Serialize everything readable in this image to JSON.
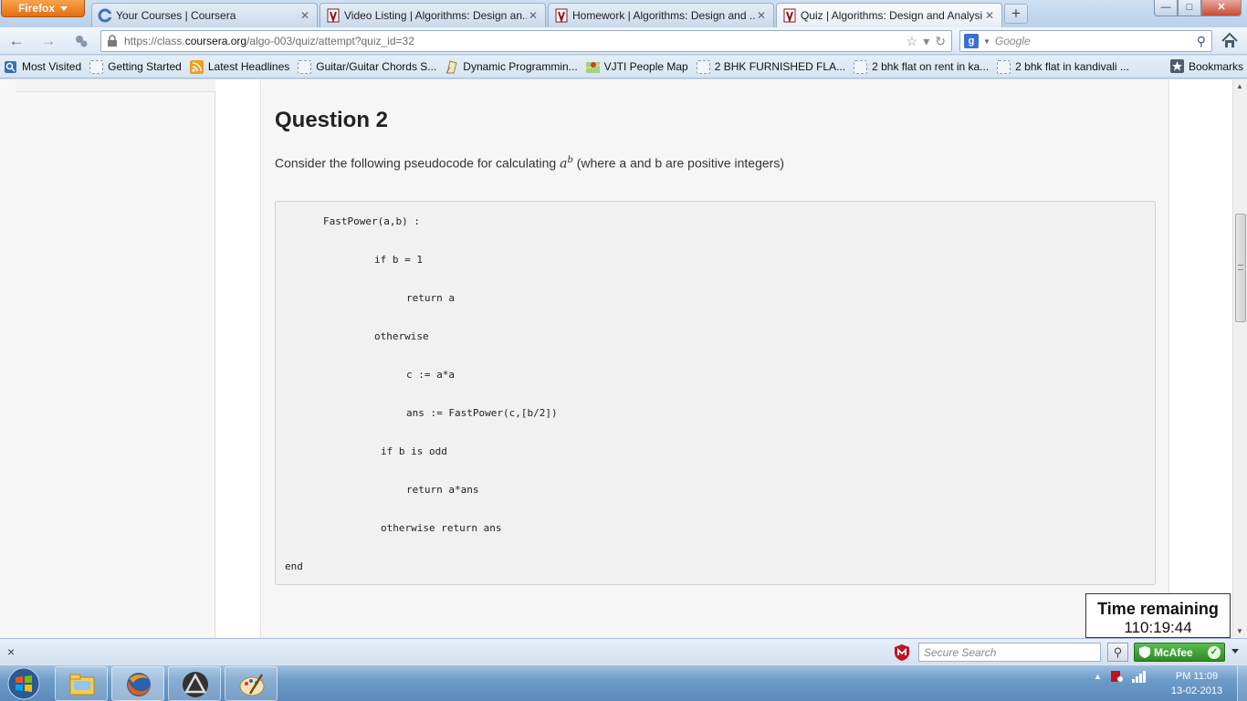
{
  "browser": {
    "menu_label": "Firefox",
    "tabs": [
      {
        "label": "Your Courses | Coursera",
        "icon": "coursera-icon"
      },
      {
        "label": "Video Listing | Algorithms: Design an...",
        "icon": "stanford-icon"
      },
      {
        "label": "Homework | Algorithms: Design and ...",
        "icon": "stanford-icon"
      },
      {
        "label": "Quiz | Algorithms: Design and Analysi...",
        "icon": "stanford-icon",
        "active": true
      }
    ],
    "new_tab_label": "+",
    "window_controls": {
      "minimize": "—",
      "maximize": "□",
      "close": "✕"
    },
    "url": {
      "prefix": "https://class.",
      "domain": "coursera.org",
      "path": "/algo-003/quiz/attempt?quiz_id=32"
    },
    "search": {
      "engine": "Google",
      "placeholder": "Google"
    },
    "bookmarks": [
      {
        "label": "Most Visited",
        "icon": "most-visited-icon"
      },
      {
        "label": "Getting Started",
        "icon": "bookmark-empty-icon"
      },
      {
        "label": "Latest Headlines",
        "icon": "rss-icon"
      },
      {
        "label": "Guitar/Guitar Chords S...",
        "icon": "bookmark-empty-icon"
      },
      {
        "label": "Dynamic Programmin...",
        "icon": "document-icon"
      },
      {
        "label": "VJTI People Map",
        "icon": "map-icon"
      },
      {
        "label": "2 BHK FURNISHED FLA...",
        "icon": "bookmark-empty-icon"
      },
      {
        "label": "2 bhk flat on rent in ka...",
        "icon": "bookmark-empty-icon"
      },
      {
        "label": "2 bhk flat in kandivali ...",
        "icon": "bookmark-empty-icon"
      }
    ],
    "bookmarks_menu_label": "Bookmarks"
  },
  "quiz": {
    "question_title": "Question 2",
    "prompt_before": "Consider the following pseudocode for calculating ",
    "prompt_base": "a",
    "prompt_exponent": "b",
    "prompt_after": " (where a and b are positive integers)",
    "code_lines": [
      "FastPower(a,b) :",
      "if b = 1",
      "return a",
      "otherwise",
      "c := a*a",
      "ans := FastPower(c,[b/2])",
      "if b is odd",
      "return a*ans",
      "otherwise return ans",
      "end"
    ],
    "timer_label": "Time remaining",
    "timer_value": "110:19:44"
  },
  "addon_bar": {
    "close_label": "×",
    "secure_search_placeholder": "Secure Search",
    "mcafee_label": "McAfee"
  },
  "taskbar": {
    "clock_time": "PM 11:09",
    "clock_date": "13-02-2013"
  },
  "colors": {
    "firefox_orange": "#e66d11",
    "mcafee_green": "#3c9a31",
    "code_background": "#f1f1f1"
  }
}
